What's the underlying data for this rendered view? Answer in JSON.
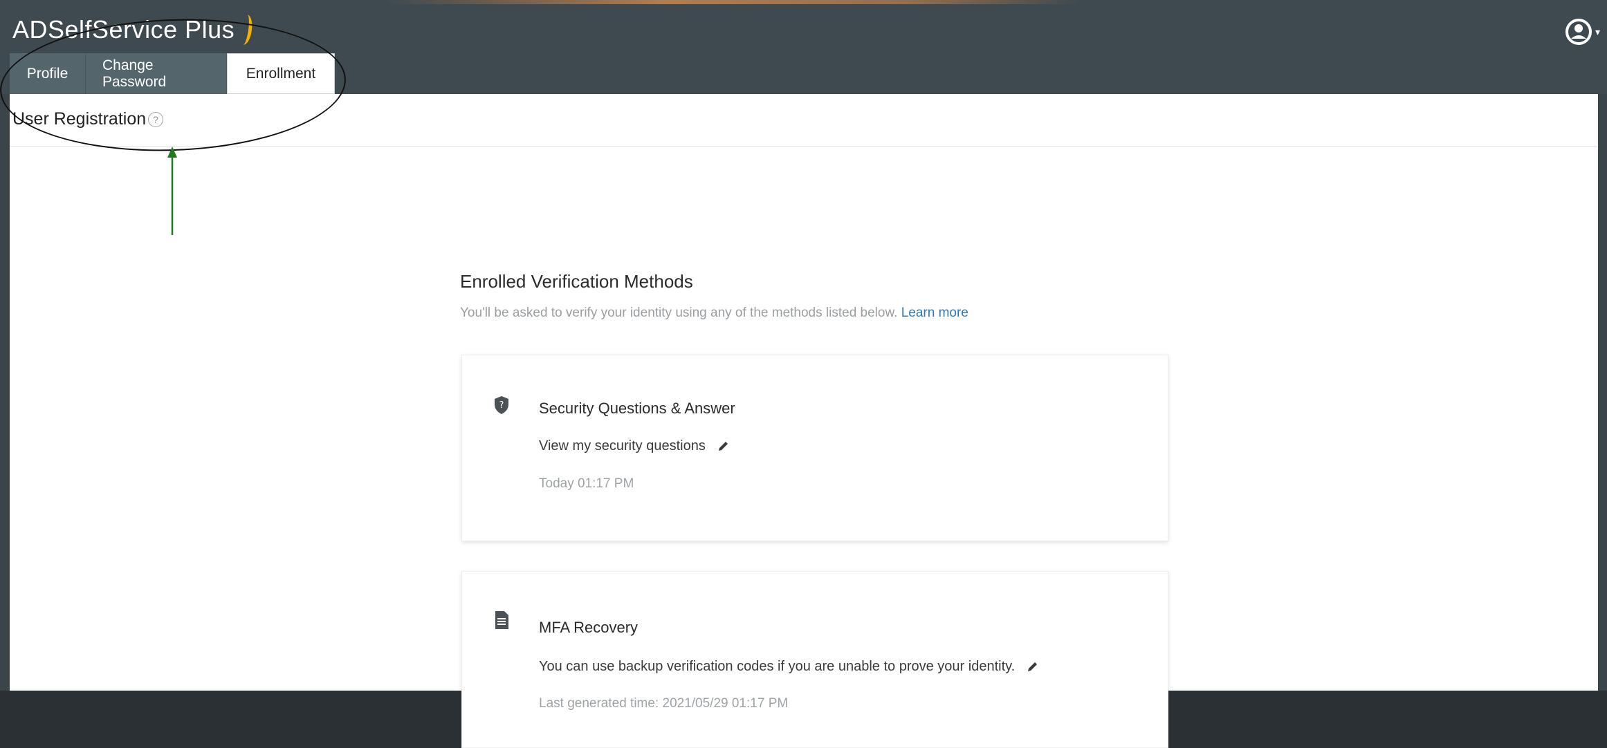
{
  "app": {
    "brand": "ADSelfService Plus",
    "user_icon": "user-circle-icon"
  },
  "tabs": [
    {
      "label": "Profile",
      "active": false
    },
    {
      "label": "Change Password",
      "active": false
    },
    {
      "label": "Enrollment",
      "active": true
    }
  ],
  "page": {
    "title": "User Registration",
    "help_glyph": "?"
  },
  "section": {
    "title": "Enrolled Verification Methods",
    "description": "You'll be asked to verify your identity using any of the methods listed below.",
    "learn_more": "Learn more"
  },
  "methods": [
    {
      "icon": "shield-question-icon",
      "title": "Security Questions & Answer",
      "action": "View my security questions",
      "meta": "Today 01:17 PM"
    },
    {
      "icon": "backup-codes-icon",
      "title": "MFA Recovery",
      "action": "You can use backup verification codes if you are unable to prove your identity.",
      "meta": "Last generated time: 2021/05/29 01:17 PM"
    }
  ],
  "colors": {
    "header_bg": "#3f4a50",
    "tab_bg": "#55656c",
    "link": "#2f78b4",
    "annotation_arrow": "#1f7a1f",
    "brand_accent": "#f2b200"
  }
}
